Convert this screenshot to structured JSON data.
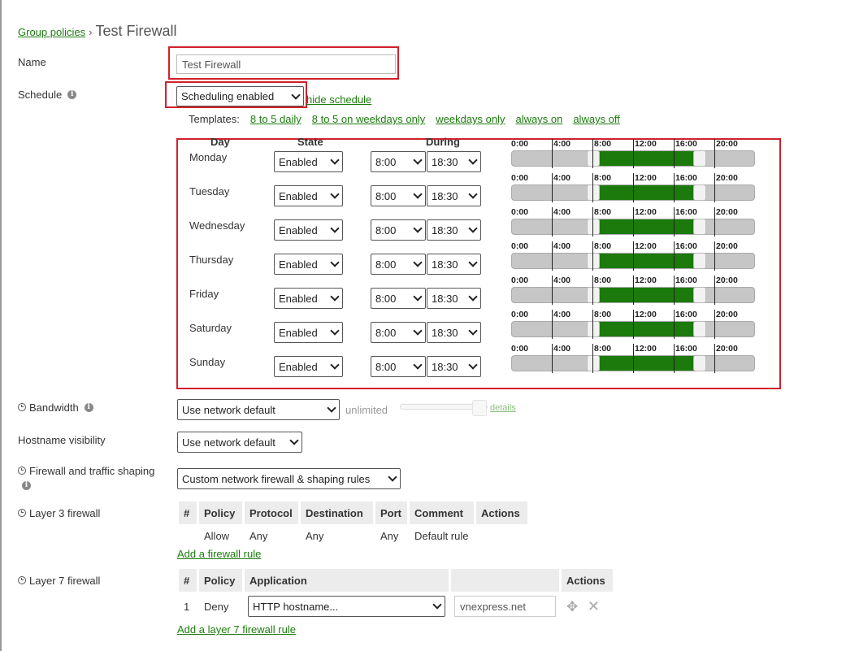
{
  "breadcrumb": {
    "parent": "Group policies",
    "separator": "›",
    "title": "Test Firewall"
  },
  "name": {
    "label": "Name",
    "value": "Test Firewall"
  },
  "schedule": {
    "label": "Schedule",
    "select_value": "Scheduling enabled",
    "hide_link": "hide schedule",
    "templates_label": "Templates:",
    "templates": [
      "8 to 5 daily",
      "8 to 5 on weekdays only",
      "weekdays only",
      "always on",
      "always off"
    ],
    "headers": {
      "day": "Day",
      "state": "State",
      "during": "During"
    },
    "tick_labels": [
      "0:00",
      "4:00",
      "8:00",
      "12:00",
      "16:00",
      "20:00"
    ],
    "days": [
      {
        "name": "Monday",
        "state": "Enabled",
        "from": "8:00",
        "to": "18:30",
        "from_hour": 8,
        "to_hour": 18.5
      },
      {
        "name": "Tuesday",
        "state": "Enabled",
        "from": "8:00",
        "to": "18:30",
        "from_hour": 8,
        "to_hour": 18.5
      },
      {
        "name": "Wednesday",
        "state": "Enabled",
        "from": "8:00",
        "to": "18:30",
        "from_hour": 8,
        "to_hour": 18.5
      },
      {
        "name": "Thursday",
        "state": "Enabled",
        "from": "8:00",
        "to": "18:30",
        "from_hour": 8,
        "to_hour": 18.5
      },
      {
        "name": "Friday",
        "state": "Enabled",
        "from": "8:00",
        "to": "18:30",
        "from_hour": 8,
        "to_hour": 18.5
      },
      {
        "name": "Saturday",
        "state": "Enabled",
        "from": "8:00",
        "to": "18:30",
        "from_hour": 8,
        "to_hour": 18.5
      },
      {
        "name": "Sunday",
        "state": "Enabled",
        "from": "8:00",
        "to": "18:30",
        "from_hour": 8,
        "to_hour": 18.5
      }
    ]
  },
  "bandwidth": {
    "label": "Bandwidth",
    "select_value": "Use network default",
    "limit_text": "unlimited",
    "details_link": "details"
  },
  "hostname": {
    "label": "Hostname visibility",
    "select_value": "Use network default"
  },
  "firewall": {
    "label": "Firewall and traffic shaping",
    "select_value": "Custom network firewall & shaping rules"
  },
  "layer3": {
    "label": "Layer 3 firewall",
    "columns": [
      "#",
      "Policy",
      "Protocol",
      "Destination",
      "Port",
      "Comment",
      "Actions"
    ],
    "rows": [
      {
        "num": "",
        "policy": "Allow",
        "protocol": "Any",
        "destination": "Any",
        "port": "Any",
        "comment": "Default rule",
        "actions": ""
      }
    ],
    "add_link": "Add a firewall rule"
  },
  "layer7": {
    "label": "Layer 7 firewall",
    "columns": [
      "#",
      "Policy",
      "Application",
      "",
      "Actions"
    ],
    "rows": [
      {
        "num": "1",
        "policy": "Deny",
        "application": "HTTP hostname...",
        "value": "vnexpress.net"
      }
    ],
    "add_link": "Add a layer 7 firewall rule"
  },
  "icons": {
    "info": "info-icon",
    "clock": "clock-icon",
    "move": "move-icon",
    "delete": "delete-icon",
    "chevron": "chevron-down-icon"
  },
  "colors": {
    "link": "#1c7c0e",
    "schedule_fill": "#1b7a0b",
    "highlight": "#d0212b"
  }
}
